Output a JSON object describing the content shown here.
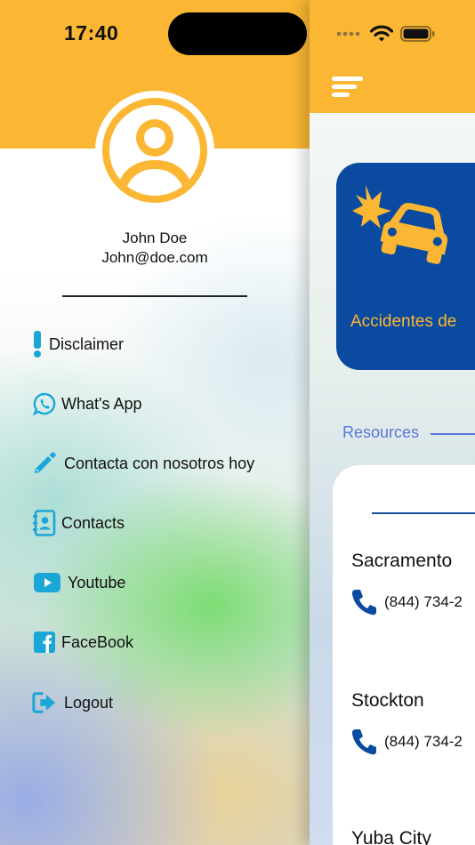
{
  "status_bar": {
    "time": "17:40"
  },
  "drawer": {
    "user": {
      "name": "John Doe",
      "email": "John@doe.com"
    },
    "menu": [
      {
        "label": "Disclaimer",
        "icon": "exclamation-icon"
      },
      {
        "label": "What's App",
        "icon": "whatsapp-icon"
      },
      {
        "label": "Contacta con nosotros hoy",
        "icon": "pencil-icon"
      },
      {
        "label": "Contacts",
        "icon": "contacts-book-icon"
      },
      {
        "label": "Youtube",
        "icon": "youtube-icon"
      },
      {
        "label": "FaceBook",
        "icon": "facebook-icon"
      },
      {
        "label": "Logout",
        "icon": "logout-icon"
      }
    ]
  },
  "main": {
    "category_card": {
      "label": "Accidentes de",
      "icon": "car-crash-icon"
    },
    "resources_label": "Resources",
    "locations": [
      {
        "city": "Sacramento",
        "phone": "(844) 734-2"
      },
      {
        "city": "Stockton",
        "phone": "(844) 734-2"
      },
      {
        "city": "Yuba City"
      }
    ]
  },
  "colors": {
    "brand_yellow": "#fbb733",
    "brand_blue": "#0a4aa0",
    "icon_cyan": "#1ba6d8",
    "link_blue": "#5a78d8"
  }
}
